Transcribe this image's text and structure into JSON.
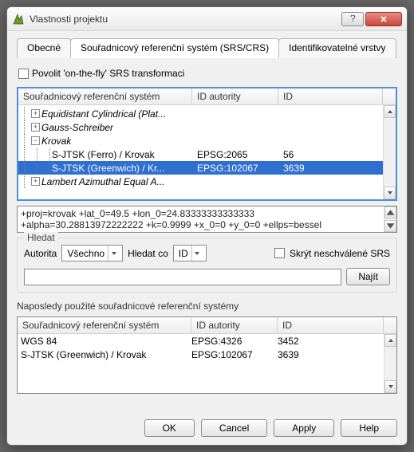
{
  "window": {
    "title": "Vlastnosti projektu"
  },
  "tabs": {
    "general": "Obecné",
    "crs": "Souřadnicový referenční systém (SRS/CRS)",
    "layers": "Identifikovatelné vrstvy"
  },
  "otf": {
    "label": "Povolit 'on-the-fly' SRS transformaci"
  },
  "headers": {
    "crs": "Souřadnicový referenční systém",
    "auth": "ID autority",
    "id": "ID"
  },
  "tree": {
    "n0": "Equidistant Cylindrical (Plat...",
    "n1": "Gauss-Schreiber",
    "n2": "Krovak",
    "n3": "S-JTSK (Ferro) / Krovak",
    "n3_auth": "EPSG:2065",
    "n3_id": "56",
    "n4": "S-JTSK (Greenwich) / Kr...",
    "n4_auth": "EPSG:102067",
    "n4_id": "3639",
    "n5": "Lambert Azimuthal Equal A..."
  },
  "proj": {
    "l1": "+proj=krovak +lat_0=49.5 +lon_0=24.83333333333333",
    "l2": "+alpha=30.28813972222222 +k=0.9999 +x_0=0 +y_0=0 +ellps=bessel"
  },
  "search": {
    "legend": "Hledat",
    "authority": "Autorita",
    "auth_val": "Všechno",
    "searchfor": "Hledat co",
    "searchfor_val": "ID",
    "hide": "Skrýt neschválené SRS",
    "find": "Najít"
  },
  "recent": {
    "label": "Naposledy použité souřadnicové referenční systémy",
    "r0_name": "WGS 84",
    "r0_auth": "EPSG:4326",
    "r0_id": "3452",
    "r1_name": "S-JTSK (Greenwich) / Krovak",
    "r1_auth": "EPSG:102067",
    "r1_id": "3639"
  },
  "buttons": {
    "ok": "OK",
    "cancel": "Cancel",
    "apply": "Apply",
    "help": "Help"
  }
}
